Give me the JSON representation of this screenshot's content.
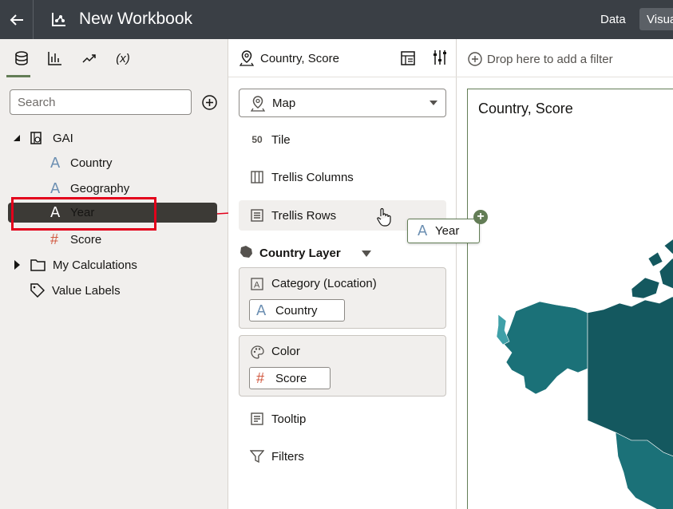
{
  "header": {
    "title": "New Workbook",
    "tabs": [
      "Data",
      "Visualize"
    ]
  },
  "data_panel": {
    "search_placeholder": "Search",
    "tree": {
      "dataset": "GAI",
      "columns": [
        {
          "name": "Country",
          "type": "attribute"
        },
        {
          "name": "Geography",
          "type": "attribute"
        },
        {
          "name": "Year",
          "type": "attribute",
          "selected": true
        },
        {
          "name": "Score",
          "type": "measure"
        }
      ],
      "my_calculations": "My Calculations",
      "value_labels": "Value Labels"
    },
    "tab_icons": [
      "database-icon",
      "bar-chart-icon",
      "trend-icon",
      "fx-icon"
    ],
    "fx_label": "(x)"
  },
  "grammar_panel": {
    "viz_title": "Country, Score",
    "viz_type": "Map",
    "drop_targets": {
      "tile": "Tile",
      "trellis_columns": "Trellis Columns",
      "trellis_rows": "Trellis Rows",
      "tooltip": "Tooltip",
      "filters": "Filters"
    },
    "layer_name": "Country Layer",
    "category_label": "Category (Location)",
    "category_value": "Country",
    "color_label": "Color",
    "color_value": "Score"
  },
  "drag": {
    "item": "Year"
  },
  "canvas": {
    "filter_placeholder": "Drop here to add a filter",
    "viz_title": "Country, Score"
  },
  "colors": {
    "header_bg": "#3a3f45",
    "accent_green": "#637d56",
    "highlight_red": "#e3001b",
    "map_dark": "#14585f",
    "map_mid": "#1b7178",
    "map_light": "#3fa0a8"
  }
}
